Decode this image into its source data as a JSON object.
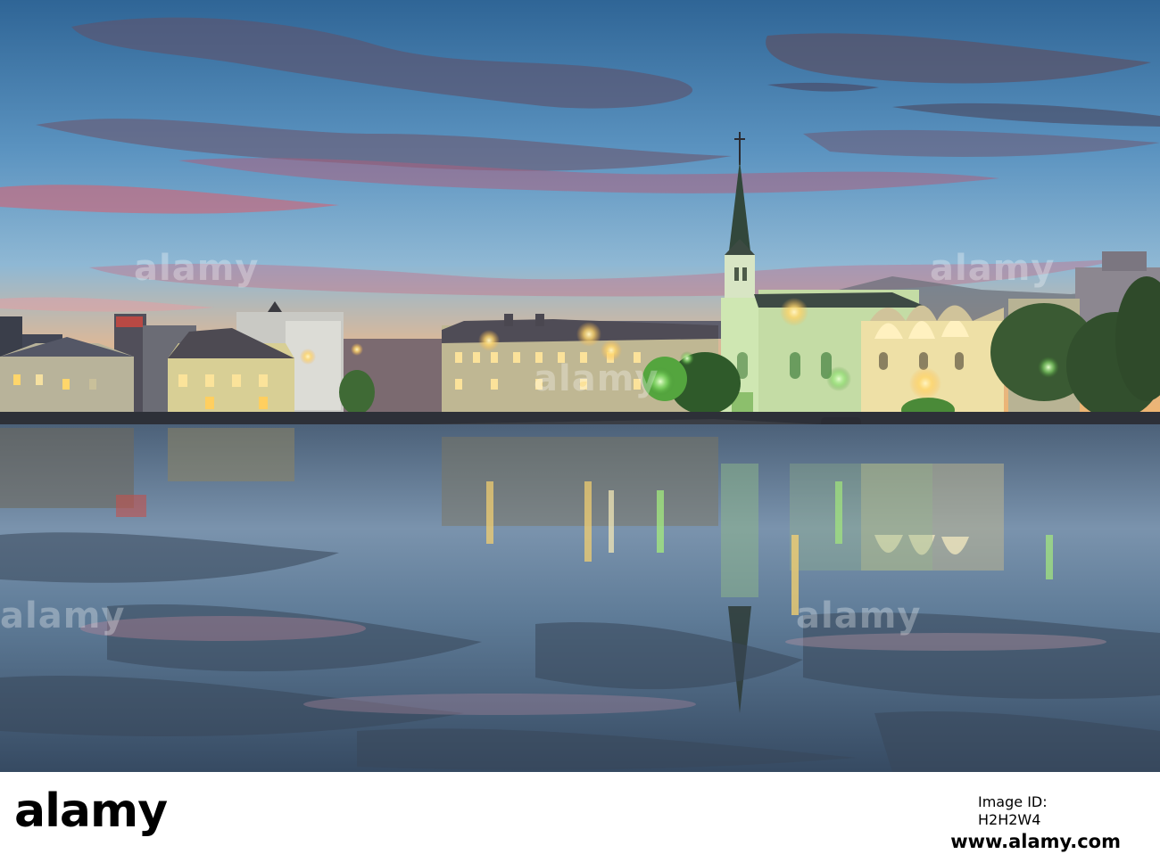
{
  "photo": {
    "subject": "reykjavik-tjornin-lake-free-church-dusk",
    "palette": {
      "sky_top": "#3a6e9c",
      "sky_mid": "#6ea3c9",
      "sky_glow": "#f3b96b",
      "cloud_pink": "#c9687c",
      "cloud_dark": "#5b5268",
      "water": "#4f6680",
      "church_light": "#d9ecc9",
      "lamp_glow": "#ffd66b",
      "tree_green": "#3f8a2e"
    }
  },
  "watermarks": [
    "alamy",
    "alamy",
    "alamy",
    "alamy",
    "alamy",
    "alamy"
  ],
  "footer": {
    "logo": "alamy",
    "image_id_label": "Image ID: H2H2W4",
    "www_line": "www.alamy.com"
  }
}
